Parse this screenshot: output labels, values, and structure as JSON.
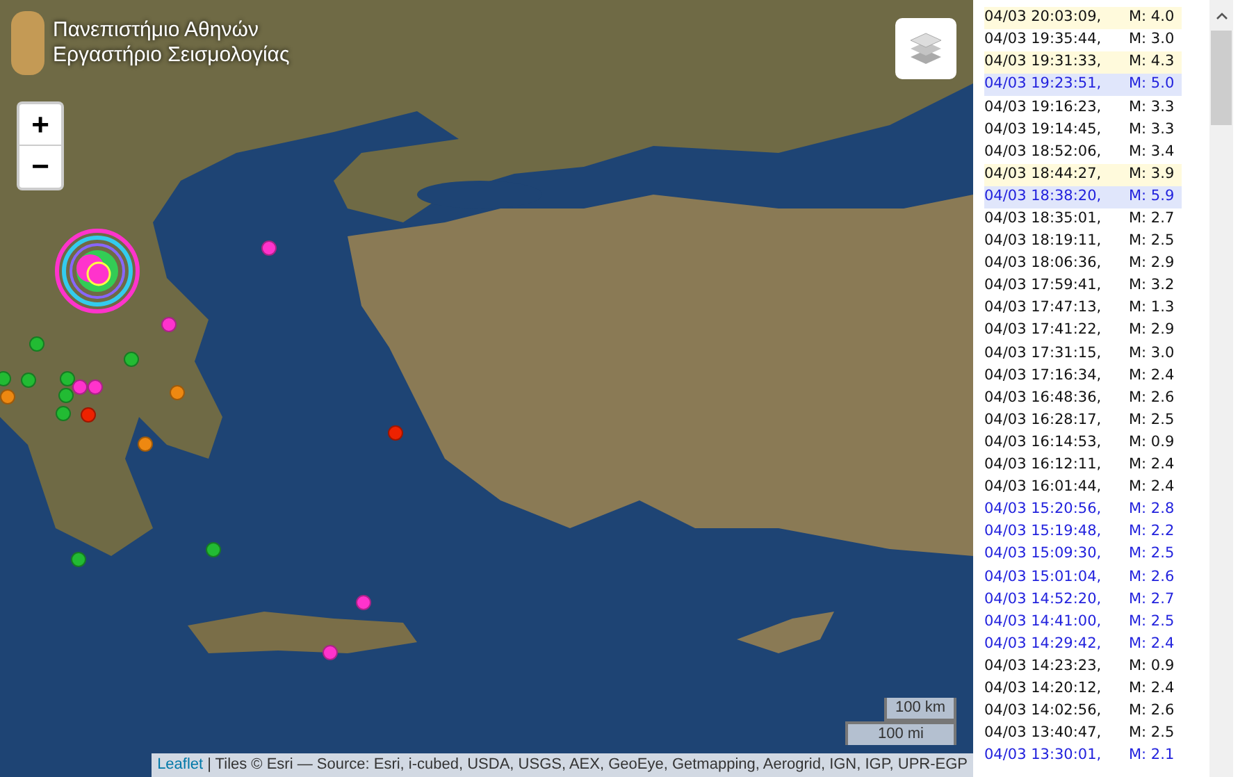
{
  "map": {
    "logo": {
      "title": "Πανεπιστήμιο Αθηνών",
      "subtitle": "Εργαστήριο Σεισμολογίας"
    },
    "zoom_in": "+",
    "zoom_out": "−",
    "markers": [
      {
        "color": "#ff33cc"
      },
      {
        "color": "#ff33cc"
      },
      {
        "color": "#22bb33"
      },
      {
        "color": "#22bb33"
      },
      {
        "color": "#22bb33"
      },
      {
        "color": "#22bb33"
      },
      {
        "color": "#22bb33"
      },
      {
        "color": "#ff33cc"
      },
      {
        "color": "#ff33cc"
      },
      {
        "color": "#22bb33"
      },
      {
        "color": "#ee8811"
      },
      {
        "color": "#ee8811"
      },
      {
        "color": "#22bb33"
      },
      {
        "color": "#ee2200"
      },
      {
        "color": "#ee8811"
      },
      {
        "color": "#ee2200"
      },
      {
        "color": "#22bb33"
      },
      {
        "color": "#22bb33"
      },
      {
        "color": "#ff33cc"
      },
      {
        "color": "#ff33cc"
      }
    ],
    "scale": {
      "metric": "100 km",
      "imperial": "100 mi"
    },
    "attribution": {
      "link": "Leaflet",
      "text": "| Tiles © Esri — Source: Esri, i-cubed, USDA, USGS, AEX, GeoEye, Getmapping, Aerogrid, IGN, IGP, UPR-EGP"
    }
  },
  "events": [
    {
      "time": "04/03 20:03:09,",
      "magnitude": "M: 4.0",
      "kind": "notable"
    },
    {
      "time": "04/03 19:35:44,",
      "magnitude": "M: 3.0",
      "kind": "plain"
    },
    {
      "time": "04/03 19:31:33,",
      "magnitude": "M: 4.3",
      "kind": "notable"
    },
    {
      "time": "04/03 19:23:51,",
      "magnitude": "M: 5.0",
      "kind": "major"
    },
    {
      "time": "04/03 19:16:23,",
      "magnitude": "M: 3.3",
      "kind": "plain"
    },
    {
      "time": "04/03 19:14:45,",
      "magnitude": "M: 3.3",
      "kind": "plain"
    },
    {
      "time": "04/03 18:52:06,",
      "magnitude": "M: 3.4",
      "kind": "plain"
    },
    {
      "time": "04/03 18:44:27,",
      "magnitude": "M: 3.9",
      "kind": "notable"
    },
    {
      "time": "04/03 18:38:20,",
      "magnitude": "M: 5.9",
      "kind": "major"
    },
    {
      "time": "04/03 18:35:01,",
      "magnitude": "M: 2.7",
      "kind": "plain"
    },
    {
      "time": "04/03 18:19:11,",
      "magnitude": "M: 2.5",
      "kind": "plain"
    },
    {
      "time": "04/03 18:06:36,",
      "magnitude": "M: 2.9",
      "kind": "plain"
    },
    {
      "time": "04/03 17:59:41,",
      "magnitude": "M: 3.2",
      "kind": "plain"
    },
    {
      "time": "04/03 17:47:13,",
      "magnitude": "M: 1.3",
      "kind": "plain"
    },
    {
      "time": "04/03 17:41:22,",
      "magnitude": "M: 2.9",
      "kind": "plain"
    },
    {
      "time": "04/03 17:31:15,",
      "magnitude": "M: 3.0",
      "kind": "plain"
    },
    {
      "time": "04/03 17:16:34,",
      "magnitude": "M: 2.4",
      "kind": "plain"
    },
    {
      "time": "04/03 16:48:36,",
      "magnitude": "M: 2.6",
      "kind": "plain"
    },
    {
      "time": "04/03 16:28:17,",
      "magnitude": "M: 2.5",
      "kind": "plain"
    },
    {
      "time": "04/03 16:14:53,",
      "magnitude": "M: 0.9",
      "kind": "plain"
    },
    {
      "time": "04/03 16:12:11,",
      "magnitude": "M: 2.4",
      "kind": "plain"
    },
    {
      "time": "04/03 16:01:44,",
      "magnitude": "M: 2.4",
      "kind": "plain"
    },
    {
      "time": "04/03 15:20:56,",
      "magnitude": "M: 2.8",
      "kind": "automatic"
    },
    {
      "time": "04/03 15:19:48,",
      "magnitude": "M: 2.2",
      "kind": "automatic"
    },
    {
      "time": "04/03 15:09:30,",
      "magnitude": "M: 2.5",
      "kind": "automatic"
    },
    {
      "time": "04/03 15:01:04,",
      "magnitude": "M: 2.6",
      "kind": "automatic"
    },
    {
      "time": "04/03 14:52:20,",
      "magnitude": "M: 2.7",
      "kind": "automatic"
    },
    {
      "time": "04/03 14:41:00,",
      "magnitude": "M: 2.5",
      "kind": "automatic"
    },
    {
      "time": "04/03 14:29:42,",
      "magnitude": "M: 2.4",
      "kind": "automatic"
    },
    {
      "time": "04/03 14:23:23,",
      "magnitude": "M: 0.9",
      "kind": "plain"
    },
    {
      "time": "04/03 14:20:12,",
      "magnitude": "M: 2.4",
      "kind": "plain"
    },
    {
      "time": "04/03 14:02:56,",
      "magnitude": "M: 2.6",
      "kind": "plain"
    },
    {
      "time": "04/03 13:40:47,",
      "magnitude": "M: 2.5",
      "kind": "plain"
    },
    {
      "time": "04/03 13:30:01,",
      "magnitude": "M: 2.1",
      "kind": "automatic"
    }
  ]
}
